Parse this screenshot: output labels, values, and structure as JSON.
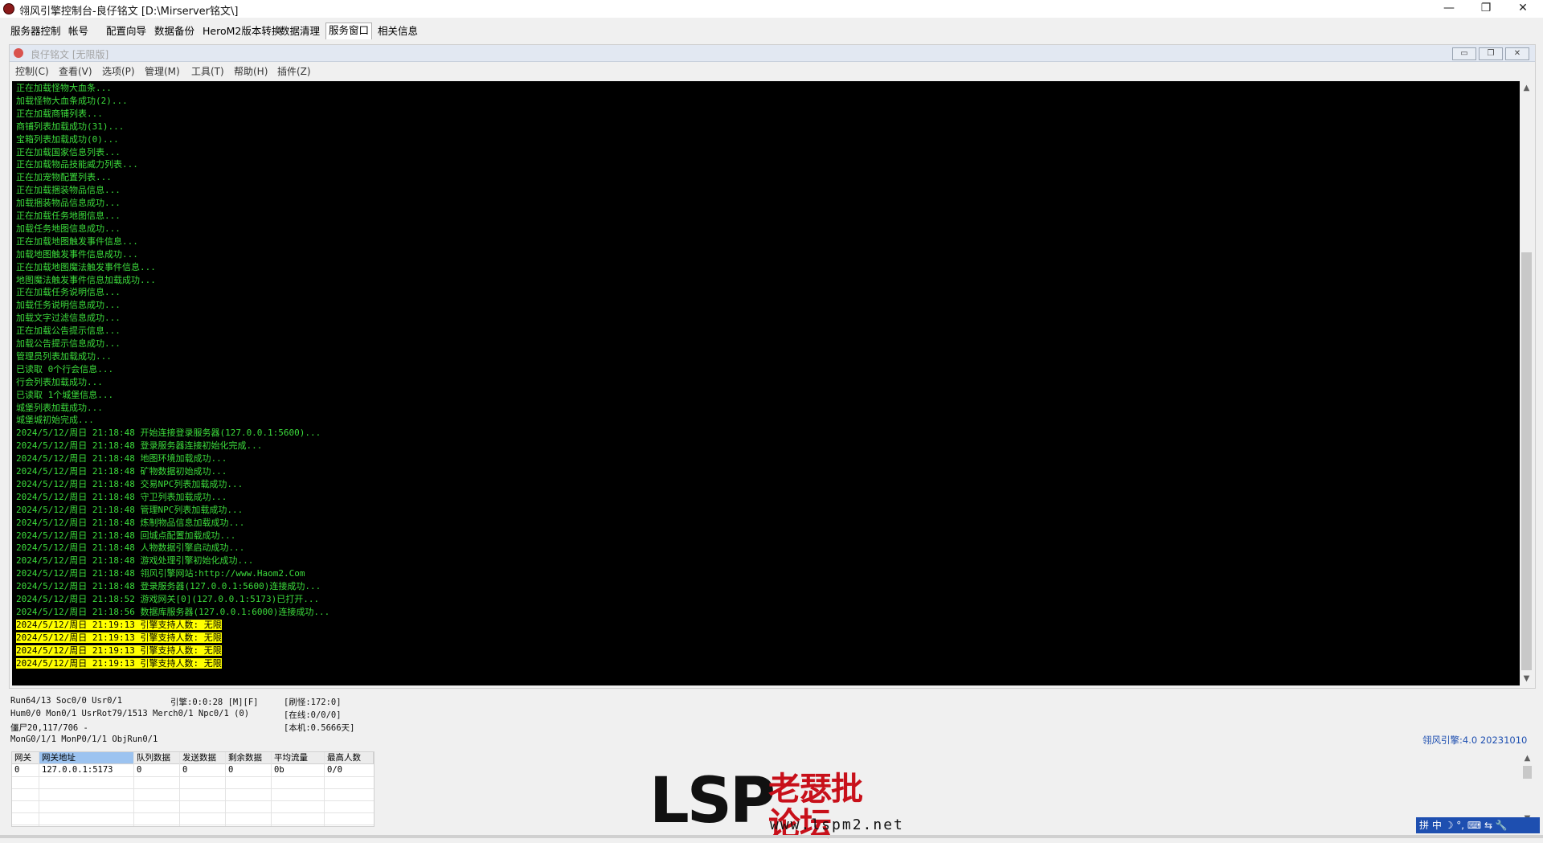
{
  "window": {
    "title": "翎风引擎控制台-良仔铭文 [D:\\Mirserver铭文\\]",
    "controls": [
      "—",
      "❐",
      "✕"
    ]
  },
  "tabs": [
    "服务器控制",
    "帐号",
    "配置向导",
    "数据备份",
    "HeroM2版本转换",
    "数据清理",
    "服务窗口",
    "相关信息"
  ],
  "active_tab": "服务窗口",
  "child_window": {
    "title": "良仔铭文 [无限版]",
    "menu": [
      "控制(C)",
      "查看(V)",
      "选项(P)",
      "管理(M)",
      "工具(T)",
      "帮助(H)",
      "插件(Z)"
    ]
  },
  "console": {
    "lines": [
      "正在加载怪物大血条...",
      "加载怪物大血条成功(2)...",
      "正在加载商铺列表...",
      "商铺列表加载成功(31)...",
      "宝箱列表加载成功(0)...",
      "正在加载国家信息列表...",
      "正在加载物品技能威力列表...",
      "正在加宠物配置列表...",
      "正在加载捆装物品信息...",
      "加载捆装物品信息成功...",
      "正在加载任务地图信息...",
      "加载任务地图信息成功...",
      "正在加载地图触发事件信息...",
      "加载地图触发事件信息成功...",
      "正在加载地图魔法触发事件信息...",
      "地图魔法触发事件信息加载成功...",
      "正在加载任务说明信息...",
      "加载任务说明信息成功...",
      "加载文字过滤信息成功...",
      "正在加载公告提示信息...",
      "加载公告提示信息成功...",
      "管理员列表加载成功...",
      "已读取 0个行会信息...",
      "行会列表加载成功...",
      "已读取 1个城堡信息...",
      "城堡列表加载成功...",
      "城堡城初始完成...",
      "2024/5/12/周日 21:18:48 开始连接登录服务器(127.0.0.1:5600)...",
      "2024/5/12/周日 21:18:48 登录服务器连接初始化完成...",
      "2024/5/12/周日 21:18:48 地图环境加载成功...",
      "2024/5/12/周日 21:18:48 矿物数据初始成功...",
      "2024/5/12/周日 21:18:48 交易NPC列表加载成功...",
      "2024/5/12/周日 21:18:48 守卫列表加载成功...",
      "2024/5/12/周日 21:18:48 管理NPC列表加载成功...",
      "2024/5/12/周日 21:18:48 炼制物品信息加载成功...",
      "2024/5/12/周日 21:18:48 回城点配置加载成功...",
      "2024/5/12/周日 21:18:48 人物数据引擎启动成功...",
      "2024/5/12/周日 21:18:48 游戏处理引擎初始化成功...",
      "2024/5/12/周日 21:18:48 翎风引擎网站:http://www.Haom2.Com",
      "2024/5/12/周日 21:18:48 登录服务器(127.0.0.1:5600)连接成功...",
      "2024/5/12/周日 21:18:52 游戏网关[0](127.0.0.1:5173)已打开...",
      "2024/5/12/周日 21:18:56 数据库服务器(127.0.0.1:6000)连接成功..."
    ],
    "highlighted_lines": [
      "2024/5/12/周日 21:19:13 引擎支持人数: 无限",
      "2024/5/12/周日 21:19:13 引擎支持人数: 无限",
      "2024/5/12/周日 21:19:13 引擎支持人数: 无限",
      "2024/5/12/周日 21:19:13 引擎支持人数: 无限"
    ],
    "text_color": "#3cdc3c",
    "highlight_color": "#ffff00"
  },
  "status": {
    "row1_left": "Run64/13 Soc0/0 Usr0/1",
    "row1_mid": "引擎:0:0:28 [M][F]",
    "row1_right": "[刷怪:172:0]",
    "row2_left": "Hum0/0 Mon0/1 UsrRot79/1513 Merch0/1 Npc0/1 (0)",
    "row2_right": "[在线:0/0/0]",
    "row3_left": "僵尸20,117/706 -",
    "row3_right": "[本机:0.5666天]",
    "row4_left": "MonG0/1/1 MonP0/1/1 ObjRun0/1",
    "version": "翎风引擎:4.0 20231010"
  },
  "gateway_table": {
    "headers": [
      "网关",
      "网关地址",
      "队列数据",
      "发送数据",
      "剩余数据",
      "平均流量",
      "最高人数"
    ],
    "rows": [
      [
        "0",
        "127.0.0.1:5173",
        "0",
        "0",
        "0",
        "0b",
        "0/0"
      ]
    ]
  },
  "watermark": {
    "brand": "LSP",
    "name": "老瑟批论坛",
    "url": "www.lspm2.net"
  },
  "ime_bar": "拼 中 ☽ °, ⌨ ⇆ 🔧"
}
